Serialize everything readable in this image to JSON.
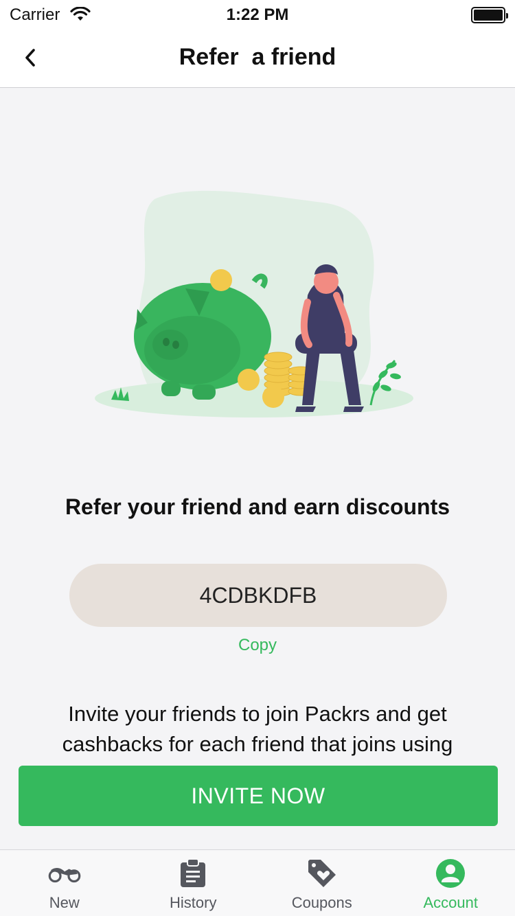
{
  "status_bar": {
    "carrier": "Carrier",
    "time": "1:22 PM"
  },
  "header": {
    "title": "Refer  a friend"
  },
  "main": {
    "headline": "Refer your friend and earn discounts",
    "referral_code": "4CDBKDFB",
    "copy_label": "Copy",
    "description": "Invite your friends to join Packrs and get cashbacks for each friend that joins using your referral code",
    "invite_button": "INVITE NOW"
  },
  "tabs": [
    {
      "label": "New",
      "icon": "motorbike-icon",
      "active": false
    },
    {
      "label": "History",
      "icon": "clipboard-icon",
      "active": false
    },
    {
      "label": "Coupons",
      "icon": "tag-heart-icon",
      "active": false
    },
    {
      "label": "Account",
      "icon": "account-icon",
      "active": true
    }
  ],
  "colors": {
    "accent": "#35b95d",
    "tab_inactive": "#55575e",
    "code_pill": "#e7e0da",
    "background": "#f4f4f6"
  }
}
